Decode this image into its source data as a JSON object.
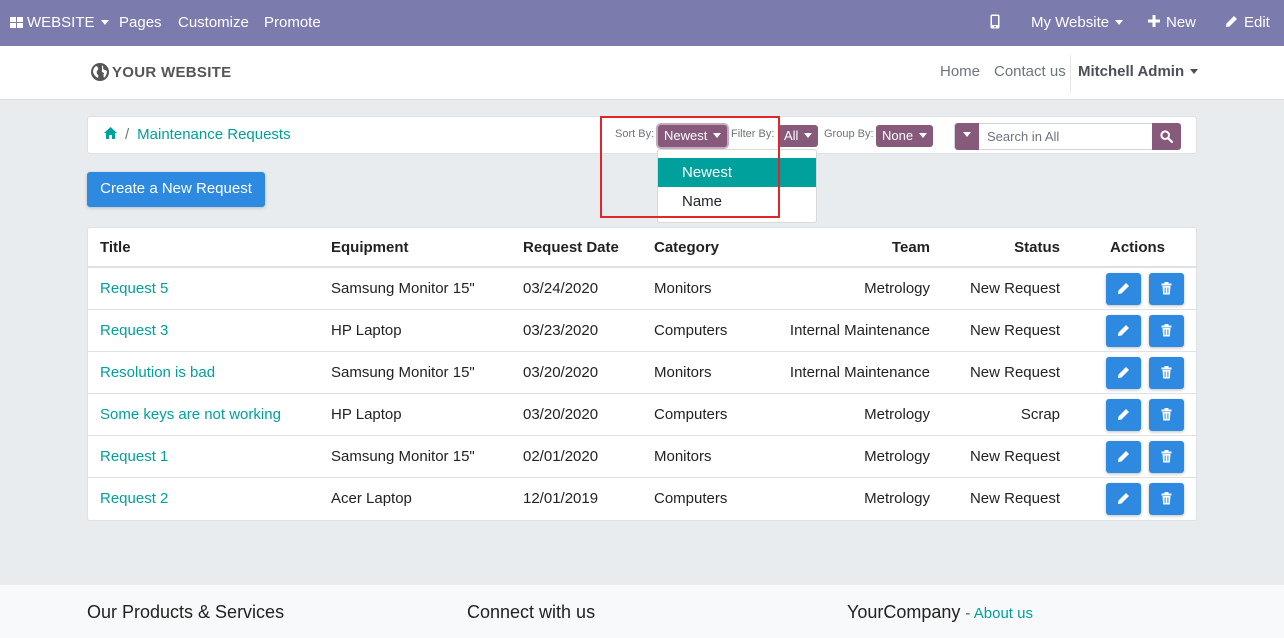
{
  "admin_bar": {
    "website_label": "WEBSITE",
    "pages": "Pages",
    "customize": "Customize",
    "promote": "Promote",
    "my_website": "My Website",
    "new_label": "New",
    "edit_label": "Edit"
  },
  "header": {
    "logo_text": "YOUR WEBSITE",
    "nav": [
      "Home",
      "Contact us"
    ],
    "user": "Mitchell Admin"
  },
  "breadcrumb": {
    "current": "Maintenance Requests"
  },
  "filters": {
    "sort_label": "Sort By:",
    "sort_value": "Newest",
    "filter_label": "Filter By:",
    "filter_value": "All",
    "group_label": "Group By:",
    "group_value": "None"
  },
  "search": {
    "placeholder": "Search in All"
  },
  "sort_dropdown": {
    "options": [
      "Newest",
      "Name"
    ],
    "selected": "Newest"
  },
  "create_button": "Create a New Request",
  "table": {
    "headers": [
      "Title",
      "Equipment",
      "Request Date",
      "Category",
      "Team",
      "Status",
      "Actions"
    ],
    "rows": [
      {
        "title": "Request 5",
        "equipment": "Samsung Monitor 15\"",
        "date": "03/24/2020",
        "category": "Monitors",
        "team": "Metrology",
        "status": "New Request"
      },
      {
        "title": "Request 3",
        "equipment": "HP Laptop",
        "date": "03/23/2020",
        "category": "Computers",
        "team": "Internal Maintenance",
        "status": "New Request"
      },
      {
        "title": "Resolution is bad",
        "equipment": "Samsung Monitor 15\"",
        "date": "03/20/2020",
        "category": "Monitors",
        "team": "Internal Maintenance",
        "status": "New Request"
      },
      {
        "title": "Some keys are not working",
        "equipment": "HP Laptop",
        "date": "03/20/2020",
        "category": "Computers",
        "team": "Metrology",
        "status": "Scrap"
      },
      {
        "title": "Request 1",
        "equipment": "Samsung Monitor 15\"",
        "date": "02/01/2020",
        "category": "Monitors",
        "team": "Metrology",
        "status": "New Request"
      },
      {
        "title": "Request 2",
        "equipment": "Acer Laptop",
        "date": "12/01/2019",
        "category": "Computers",
        "team": "Metrology",
        "status": "New Request"
      }
    ]
  },
  "footer": {
    "col1_title": "Our Products & Services",
    "col2_title": "Connect with us",
    "col3_title": "YourCompany",
    "col3_link": "About us"
  },
  "colors": {
    "admin_bar": "#7c7bad",
    "brand": "#875a7b",
    "link": "#00a09d",
    "primary_button": "#2d8ae0",
    "highlight": "#e0262b"
  },
  "icons": {
    "apps": "apps-grid-icon",
    "mobile": "mobile-icon",
    "plus": "plus-icon",
    "edit": "pencil-icon",
    "globe": "globe-icon",
    "home": "home-icon",
    "search": "search-icon",
    "row_edit": "pencil-icon",
    "row_delete": "trash-icon"
  }
}
